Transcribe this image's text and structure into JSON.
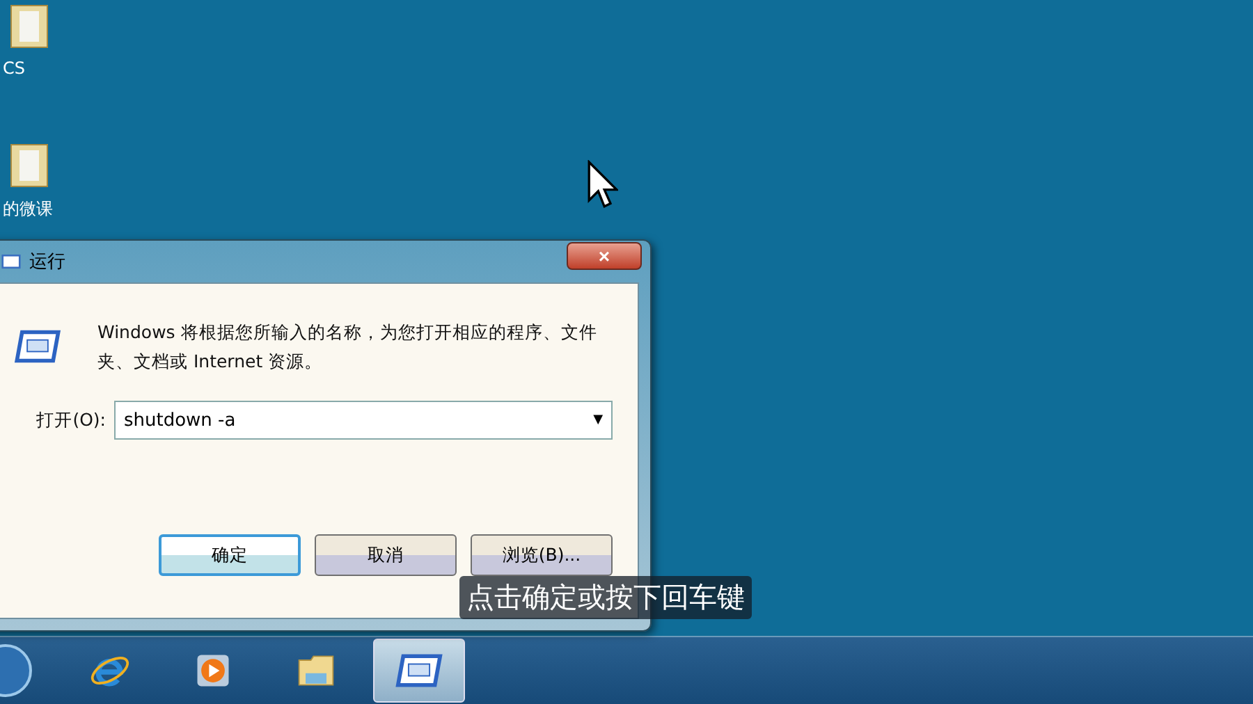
{
  "desktop_icons": [
    {
      "label": "CS"
    },
    {
      "label": "的微课"
    }
  ],
  "run_dialog": {
    "title": "运行",
    "close": "×",
    "description": "Windows 将根据您所输入的名称，为您打开相应的程序、文件夹、文档或 Internet 资源。",
    "open_label": "打开(O):",
    "open_value": "shutdown -a",
    "dropdown": "▼",
    "buttons": [
      {
        "label": "确定",
        "default": true
      },
      {
        "label": "取消",
        "default": false
      },
      {
        "label": "浏览(B)...",
        "default": false
      }
    ]
  },
  "caption": "点击确定或按下回车键",
  "taskbar": {
    "items": [
      {
        "kind": "ie",
        "selected": false
      },
      {
        "kind": "media",
        "selected": false
      },
      {
        "kind": "explorer",
        "selected": false
      },
      {
        "kind": "run",
        "selected": true
      }
    ]
  }
}
